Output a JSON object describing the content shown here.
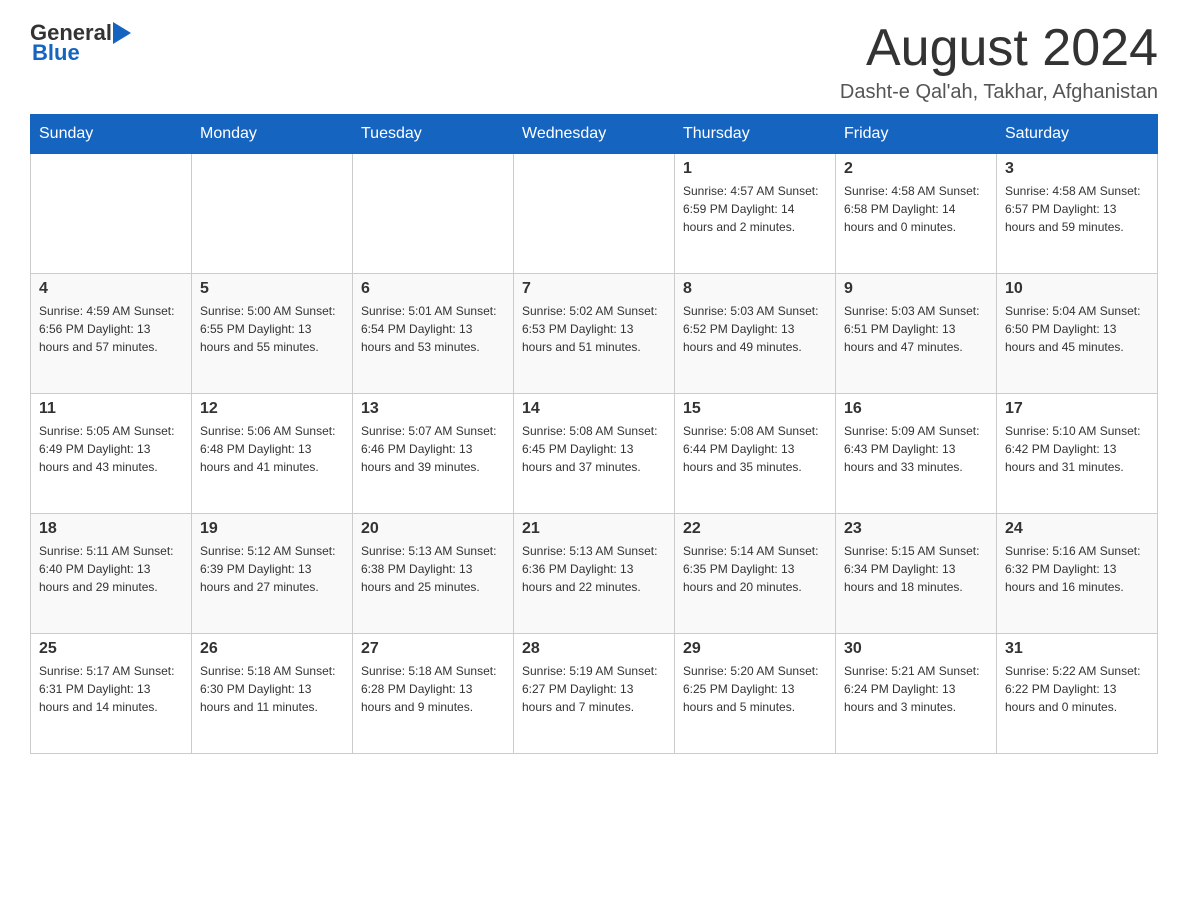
{
  "header": {
    "logo_general": "General",
    "logo_blue": "Blue",
    "month_title": "August 2024",
    "location": "Dasht-e Qal'ah, Takhar, Afghanistan"
  },
  "days_of_week": [
    "Sunday",
    "Monday",
    "Tuesday",
    "Wednesday",
    "Thursday",
    "Friday",
    "Saturday"
  ],
  "weeks": [
    {
      "days": [
        {
          "number": "",
          "info": ""
        },
        {
          "number": "",
          "info": ""
        },
        {
          "number": "",
          "info": ""
        },
        {
          "number": "",
          "info": ""
        },
        {
          "number": "1",
          "info": "Sunrise: 4:57 AM\nSunset: 6:59 PM\nDaylight: 14 hours\nand 2 minutes."
        },
        {
          "number": "2",
          "info": "Sunrise: 4:58 AM\nSunset: 6:58 PM\nDaylight: 14 hours\nand 0 minutes."
        },
        {
          "number": "3",
          "info": "Sunrise: 4:58 AM\nSunset: 6:57 PM\nDaylight: 13 hours\nand 59 minutes."
        }
      ]
    },
    {
      "days": [
        {
          "number": "4",
          "info": "Sunrise: 4:59 AM\nSunset: 6:56 PM\nDaylight: 13 hours\nand 57 minutes."
        },
        {
          "number": "5",
          "info": "Sunrise: 5:00 AM\nSunset: 6:55 PM\nDaylight: 13 hours\nand 55 minutes."
        },
        {
          "number": "6",
          "info": "Sunrise: 5:01 AM\nSunset: 6:54 PM\nDaylight: 13 hours\nand 53 minutes."
        },
        {
          "number": "7",
          "info": "Sunrise: 5:02 AM\nSunset: 6:53 PM\nDaylight: 13 hours\nand 51 minutes."
        },
        {
          "number": "8",
          "info": "Sunrise: 5:03 AM\nSunset: 6:52 PM\nDaylight: 13 hours\nand 49 minutes."
        },
        {
          "number": "9",
          "info": "Sunrise: 5:03 AM\nSunset: 6:51 PM\nDaylight: 13 hours\nand 47 minutes."
        },
        {
          "number": "10",
          "info": "Sunrise: 5:04 AM\nSunset: 6:50 PM\nDaylight: 13 hours\nand 45 minutes."
        }
      ]
    },
    {
      "days": [
        {
          "number": "11",
          "info": "Sunrise: 5:05 AM\nSunset: 6:49 PM\nDaylight: 13 hours\nand 43 minutes."
        },
        {
          "number": "12",
          "info": "Sunrise: 5:06 AM\nSunset: 6:48 PM\nDaylight: 13 hours\nand 41 minutes."
        },
        {
          "number": "13",
          "info": "Sunrise: 5:07 AM\nSunset: 6:46 PM\nDaylight: 13 hours\nand 39 minutes."
        },
        {
          "number": "14",
          "info": "Sunrise: 5:08 AM\nSunset: 6:45 PM\nDaylight: 13 hours\nand 37 minutes."
        },
        {
          "number": "15",
          "info": "Sunrise: 5:08 AM\nSunset: 6:44 PM\nDaylight: 13 hours\nand 35 minutes."
        },
        {
          "number": "16",
          "info": "Sunrise: 5:09 AM\nSunset: 6:43 PM\nDaylight: 13 hours\nand 33 minutes."
        },
        {
          "number": "17",
          "info": "Sunrise: 5:10 AM\nSunset: 6:42 PM\nDaylight: 13 hours\nand 31 minutes."
        }
      ]
    },
    {
      "days": [
        {
          "number": "18",
          "info": "Sunrise: 5:11 AM\nSunset: 6:40 PM\nDaylight: 13 hours\nand 29 minutes."
        },
        {
          "number": "19",
          "info": "Sunrise: 5:12 AM\nSunset: 6:39 PM\nDaylight: 13 hours\nand 27 minutes."
        },
        {
          "number": "20",
          "info": "Sunrise: 5:13 AM\nSunset: 6:38 PM\nDaylight: 13 hours\nand 25 minutes."
        },
        {
          "number": "21",
          "info": "Sunrise: 5:13 AM\nSunset: 6:36 PM\nDaylight: 13 hours\nand 22 minutes."
        },
        {
          "number": "22",
          "info": "Sunrise: 5:14 AM\nSunset: 6:35 PM\nDaylight: 13 hours\nand 20 minutes."
        },
        {
          "number": "23",
          "info": "Sunrise: 5:15 AM\nSunset: 6:34 PM\nDaylight: 13 hours\nand 18 minutes."
        },
        {
          "number": "24",
          "info": "Sunrise: 5:16 AM\nSunset: 6:32 PM\nDaylight: 13 hours\nand 16 minutes."
        }
      ]
    },
    {
      "days": [
        {
          "number": "25",
          "info": "Sunrise: 5:17 AM\nSunset: 6:31 PM\nDaylight: 13 hours\nand 14 minutes."
        },
        {
          "number": "26",
          "info": "Sunrise: 5:18 AM\nSunset: 6:30 PM\nDaylight: 13 hours\nand 11 minutes."
        },
        {
          "number": "27",
          "info": "Sunrise: 5:18 AM\nSunset: 6:28 PM\nDaylight: 13 hours\nand 9 minutes."
        },
        {
          "number": "28",
          "info": "Sunrise: 5:19 AM\nSunset: 6:27 PM\nDaylight: 13 hours\nand 7 minutes."
        },
        {
          "number": "29",
          "info": "Sunrise: 5:20 AM\nSunset: 6:25 PM\nDaylight: 13 hours\nand 5 minutes."
        },
        {
          "number": "30",
          "info": "Sunrise: 5:21 AM\nSunset: 6:24 PM\nDaylight: 13 hours\nand 3 minutes."
        },
        {
          "number": "31",
          "info": "Sunrise: 5:22 AM\nSunset: 6:22 PM\nDaylight: 13 hours\nand 0 minutes."
        }
      ]
    }
  ]
}
